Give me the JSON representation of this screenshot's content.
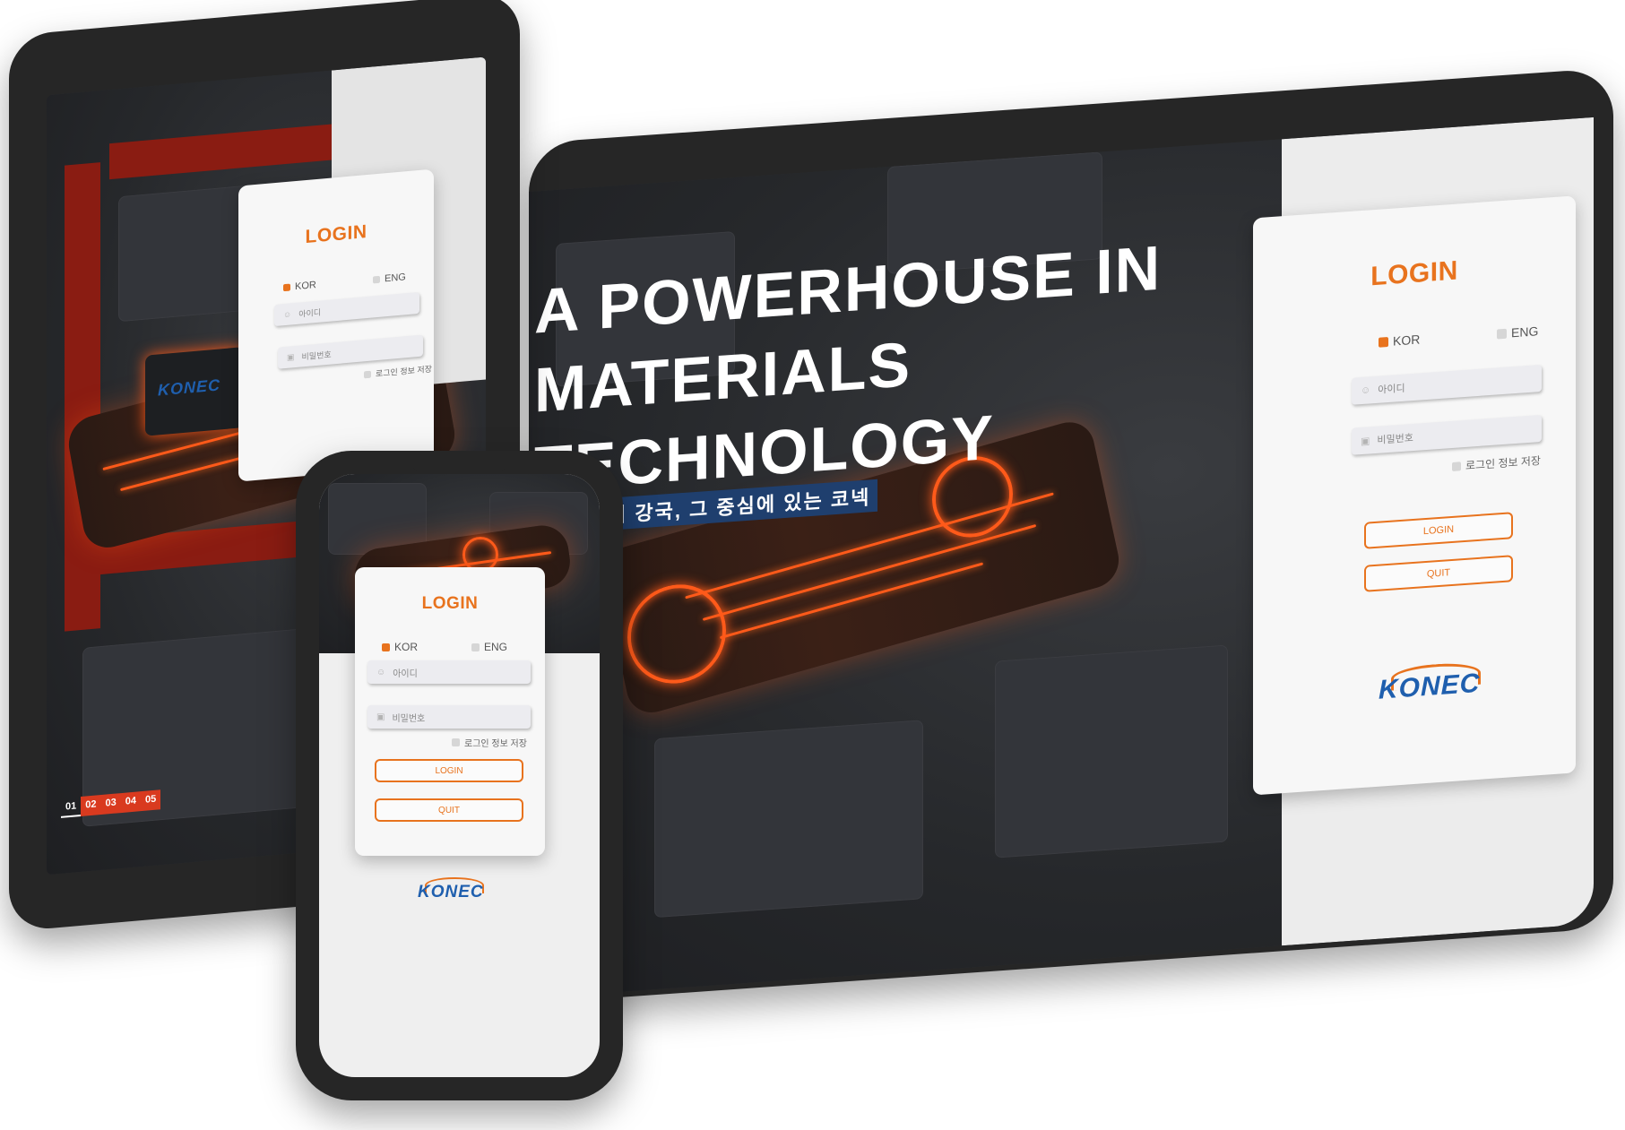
{
  "monitor": {
    "hero_title": "A POWERHOUSE IN\nMATERIALS\nTECHNOLOGY",
    "hero_subtitle": "의 강국, 그 중심에 있는 코넥",
    "login": {
      "title": "LOGIN",
      "lang_kor": "KOR",
      "lang_eng": "ENG",
      "id_placeholder": "아이디",
      "pw_placeholder": "비밀번호",
      "remember": "로그인 정보 저장",
      "login_button": "LOGIN",
      "quit_button": "QUIT"
    },
    "logo": "KONEC"
  },
  "tablet": {
    "login": {
      "title": "LOGIN",
      "lang_kor": "KOR",
      "lang_eng": "ENG",
      "id_placeholder": "아이디",
      "pw_placeholder": "비밀번호",
      "remember": "로그인 정보 저장"
    },
    "chip_logo": "KONEC",
    "pager": [
      "01",
      "02",
      "03",
      "04",
      "05"
    ]
  },
  "phone": {
    "login": {
      "title": "LOGIN",
      "lang_kor": "KOR",
      "lang_eng": "ENG",
      "id_placeholder": "아이디",
      "pw_placeholder": "비밀번호",
      "remember": "로그인 정보 저장",
      "login_button": "LOGIN",
      "quit_button": "QUIT"
    },
    "logo": "KONEC"
  },
  "icons": {
    "user": "user-icon",
    "lock": "lock-icon",
    "checkbox": "checkbox-icon"
  },
  "colors": {
    "accent_orange": "#e8731e",
    "logo_blue": "#1f5fae",
    "hero_bg": "#26282b",
    "neon_orange": "#ff5a1a",
    "pager_red": "#d93a1f",
    "subtitle_band": "#1f3f6e"
  }
}
